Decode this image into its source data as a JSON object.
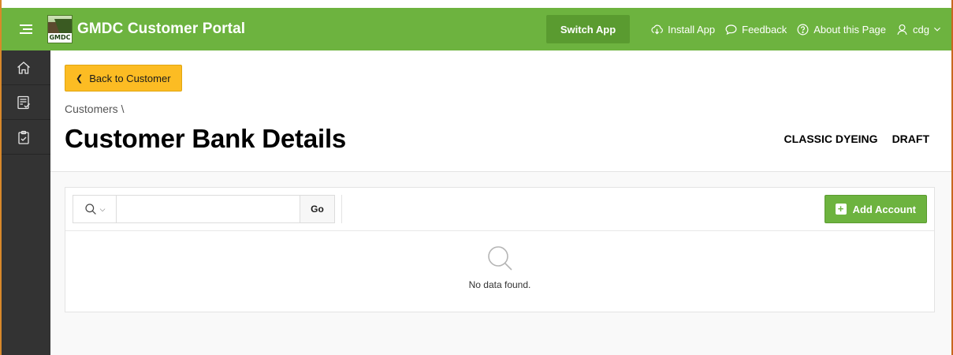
{
  "header": {
    "app_title": "GMDC Customer Portal",
    "logo_text": "GMDC",
    "switch_app": "Switch App",
    "install_app": "Install App",
    "feedback": "Feedback",
    "about": "About this Page",
    "user": "cdg"
  },
  "sidebar": {
    "items": [
      {
        "icon": "home-icon"
      },
      {
        "icon": "checklist-icon"
      },
      {
        "icon": "clipboard-check-icon"
      }
    ]
  },
  "title_region": {
    "back_label": "Back to Customer",
    "breadcrumb": "Customers \\",
    "page_title": "Customer Bank Details",
    "customer_name": "CLASSIC DYEING",
    "status": "DRAFT"
  },
  "report": {
    "search_value": "",
    "go_label": "Go",
    "add_label": "Add Account",
    "no_data": "No data found."
  },
  "colors": {
    "header_green": "#6db33f",
    "sidebar": "#333333",
    "back_button": "#fcbc23"
  }
}
